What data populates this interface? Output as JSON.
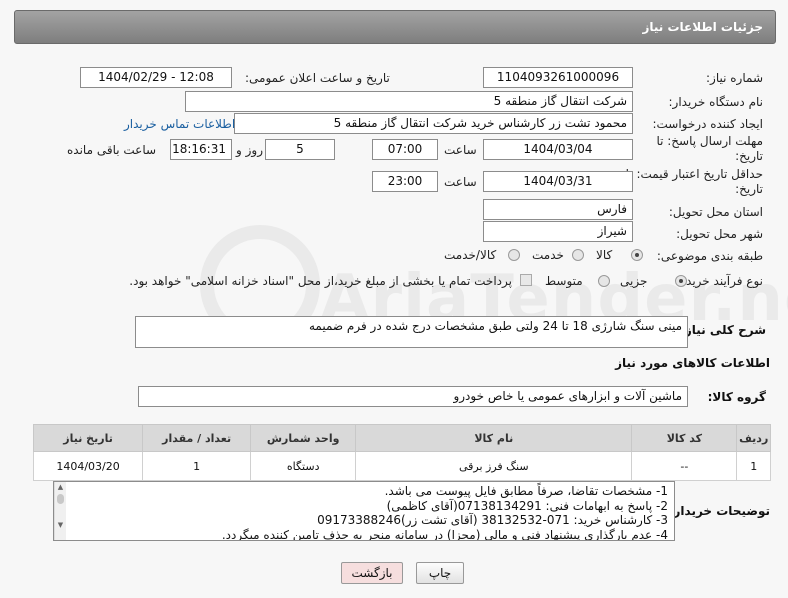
{
  "header": {
    "title": "جزئیات اطلاعات نیاز"
  },
  "labels": {
    "need_number": "شماره نیاز:",
    "announce_datetime": "تاریخ و ساعت اعلان عمومی:",
    "buyer_org": "نام دستگاه خریدار:",
    "creator": "ایجاد کننده درخواست:",
    "contact_link": "اطلاعات تماس خریدار",
    "reply_deadline": "مهلت ارسال پاسخ: تا تاریخ:",
    "time": "ساعت",
    "day_and": "روز و",
    "remaining": "ساعت باقی مانده",
    "price_validity": "حداقل تاریخ اعتبار قیمت: تا تاریخ:",
    "province": "استان محل تحویل:",
    "city": "شهر محل تحویل:",
    "category": "طبقه بندی موضوعی:",
    "process": "نوع فرآیند خرید :",
    "payment_note": "پرداخت تمام یا بخشی از مبلغ خرید،از محل \"اسناد خزانه اسلامی\" خواهد بود.",
    "description": "شرح کلی نیاز:",
    "goods_info": "اطلاعات کالاهای مورد نیاز",
    "goods_group": "گروه کالا:",
    "buyer_notes": "توضیحات خریدار:"
  },
  "fields": {
    "need_number": "1104093261000096",
    "announce_datetime": "1404/02/29 - 12:08",
    "buyer_org": "شرکت انتقال گاز منطقه 5",
    "creator": "محمود تشت زر کارشناس خرید شرکت انتقال گاز منطقه 5",
    "reply_date": "1404/03/04",
    "reply_time": "07:00",
    "days": "5",
    "remaining_time": "18:16:31",
    "validity_date": "1404/03/31",
    "validity_time": "23:00",
    "province": "فارس",
    "city": "شیراز",
    "description": "مینی سنگ شارژی 18 تا 24 ولتی طبق مشخصات درج شده در فرم ضمیمه",
    "goods_group": "ماشین آلات و ابزارهای عمومی یا خاص خودرو"
  },
  "category_options": [
    {
      "label": "کالا",
      "selected": true
    },
    {
      "label": "خدمت",
      "selected": false
    },
    {
      "label": "کالا/خدمت",
      "selected": false
    }
  ],
  "process_options": [
    {
      "label": "جزیی",
      "selected": true
    },
    {
      "label": "متوسط",
      "selected": false
    }
  ],
  "table": {
    "headers": [
      "ردیف",
      "کد کالا",
      "نام کالا",
      "واحد شمارش",
      "تعداد / مقدار",
      "تاریخ نیاز"
    ],
    "rows": [
      [
        "1",
        "--",
        "سنگ فرز برقی",
        "دستگاه",
        "1",
        "1404/03/20"
      ]
    ]
  },
  "notes": [
    "1-  مشخصات تقاضا، صرفاً مطابق فایل پیوست می باشد.",
    "2- پاسخ به ابهامات فنی: 07138134291(آقای کاظمی)",
    "3- کارشناس خرید: 071-38132532 (آقای تشت زر)09173388246",
    "4- عدم بارگذاری پیشنهاد فنی و مالی (مجزا) در سامانه منجر به حذف تامین کننده میگردد."
  ],
  "buttons": {
    "print": "چاپ",
    "back": "بازگشت"
  },
  "watermark": "AriaTender.neT",
  "colors": {
    "header_bg": "#8f8f8f",
    "link": "#1a5fa0",
    "back_button_bg": "#f6dede"
  }
}
